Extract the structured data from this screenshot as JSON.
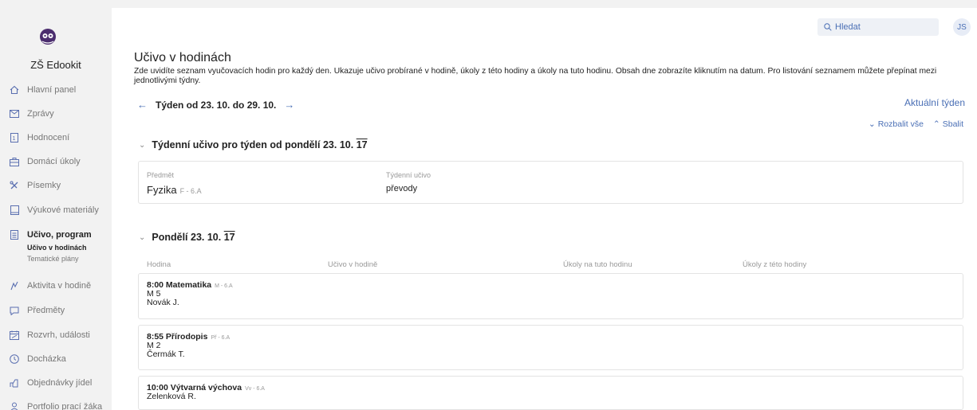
{
  "app": {
    "name": "ZŠ Edookit",
    "logo_icon": "owl-logo-icon"
  },
  "sidebar": {
    "items": [
      {
        "label": "Hlavní panel",
        "icon": "home-icon"
      },
      {
        "label": "Zprávy",
        "icon": "mail-icon"
      },
      {
        "label": "Hodnocení",
        "icon": "grade-icon"
      },
      {
        "label": "Domácí úkoly",
        "icon": "homework-icon"
      },
      {
        "label": "Písemky",
        "icon": "tests-icon"
      },
      {
        "label": "Výukové materiály",
        "icon": "materials-icon"
      },
      {
        "label": "Učivo, program",
        "icon": "curriculum-icon"
      },
      {
        "label": "Aktivita v hodině",
        "icon": "activity-icon"
      },
      {
        "label": "Předměty",
        "icon": "subjects-icon"
      },
      {
        "label": "Rozvrh, události",
        "icon": "calendar-icon"
      },
      {
        "label": "Docházka",
        "icon": "clock-icon"
      },
      {
        "label": "Objednávky jídel",
        "icon": "food-icon"
      },
      {
        "label": "Portfolio prací žáka",
        "icon": "portfolio-icon"
      }
    ],
    "subitems": {
      "current": "Učivo v hodinách",
      "other": "Tematické plány"
    }
  },
  "header": {
    "search_placeholder": "Hledat",
    "user_initials": "JS"
  },
  "page": {
    "title": "Učivo v hodinách",
    "description": "Zde uvidíte seznam vyučovacích hodin pro každý den. Ukazuje učivo probírané v hodině, úkoly z této hodiny a úkoly na tuto hodinu. Obsah dne zobrazíte kliknutím na datum. Pro listování seznamem můžete přepínat mezi jednotlivými týdny.",
    "week_label": "Týden od 23. 10. do 29. 10.",
    "prev_arrow": "←",
    "next_arrow": "→",
    "current_week": "Aktuální týden",
    "expand_all": "Rozbalit vše",
    "collapse": "Sbalit"
  },
  "weekly": {
    "heading": "Týdenní učivo pro týden od pondělí 23. 10.",
    "heading_suffix": "17",
    "col_subject": "Předmět",
    "col_weekly": "Týdenní učivo",
    "subject": "Fyzika",
    "subject_code": "F - 6.A",
    "value": "převody"
  },
  "day": {
    "heading": "Pondělí 23. 10.",
    "heading_suffix": "17",
    "columns": [
      "Hodina",
      "Učivo v hodině",
      "Úkoly na tuto hodinu",
      "Úkoly z této hodiny"
    ],
    "lessons": [
      {
        "title": "8:00 Matematika",
        "code": "M - 6.A",
        "room": "M 5",
        "teacher": "Novák J."
      },
      {
        "title": "8:55 Přírodopis",
        "code": "Př - 6.A",
        "room": "M 2",
        "teacher": "Čermák T."
      },
      {
        "title": "10:00 Výtvarná výchova",
        "code": "Vv - 6.A",
        "teacher": "Zelenková R."
      }
    ]
  },
  "colors": {
    "accent": "#4a6fb5",
    "background": "#f2f2f2"
  }
}
